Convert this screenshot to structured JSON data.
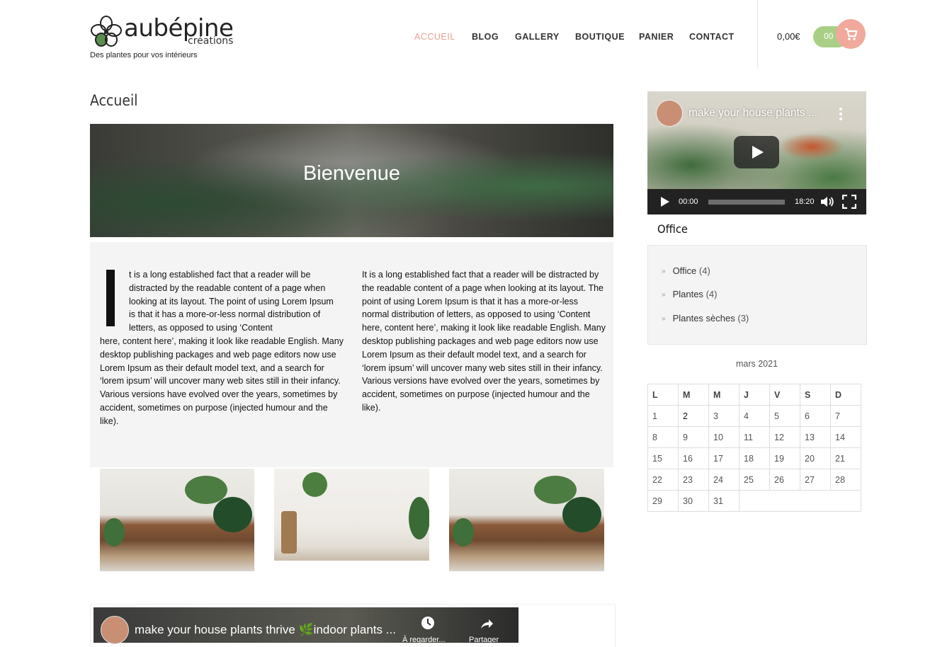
{
  "brand": {
    "name": "aubépine",
    "sub": "créations",
    "tagline": "Des plantes pour vos intérieurs"
  },
  "nav": {
    "items": [
      "ACCUEIL",
      "BLOG",
      "GALLERY",
      "BOUTIQUE",
      "PANIER",
      "CONTACT"
    ],
    "active": "ACCUEIL"
  },
  "cart": {
    "total": "0,00€",
    "count": "00"
  },
  "colors": {
    "accent": "#e8a08f",
    "cart_green": "#a9cf86",
    "cart_pink": "#f0a99c"
  },
  "main": {
    "page_title": "Accueil",
    "hero_title": "Bienvenue",
    "dropcap": "I",
    "col1_first": "t is a long established fact that a reader will be distracted by the readable content of a page when looking at its layout. The point of using Lorem Ipsum is that it has a more-or-less normal distribution of letters, as opposed to using ‘Content",
    "col1_rest": "here, content here’, making it look like readable English. Many desktop publishing packages and web page editors now use Lorem Ipsum as their default model text, and a search for ‘lorem ipsum’ will uncover many web sites still in their infancy. Various versions have evolved over the years, sometimes by accident, sometimes on purpose (injected humour and the like).",
    "col2": "It is a long established fact that a reader will be distracted by the readable content of a page when looking at its layout. The point of using Lorem Ipsum is that it has a more-or-less normal distribution of letters, as opposed to using ‘Content here, content here’, making it look like readable English. Many desktop publishing packages and web page editors now use Lorem Ipsum as their default model text, and a search for ‘lorem ipsum’ will uncover many web sites still in their infancy. Various versions have evolved over the years, sometimes by accident, sometimes on purpose (injected humour and the like).",
    "video": {
      "title": "make your house plants thrive 🌿indoor plants ...",
      "action1": "À regarder...",
      "action2": "Partager"
    }
  },
  "sidebar": {
    "video": {
      "title": "make your house plants ...",
      "time_current": "00:00",
      "time_total": "18:20"
    },
    "categories_title": "Office",
    "categories": [
      {
        "name": "Office",
        "count": "(4)"
      },
      {
        "name": "Plantes",
        "count": "(4)"
      },
      {
        "name": "Plantes sèches",
        "count": "(3)"
      }
    ],
    "calendar": {
      "caption": "mars 2021",
      "days": [
        "L",
        "M",
        "M",
        "J",
        "V",
        "S",
        "D"
      ],
      "weeks": [
        [
          "1",
          "2",
          "3",
          "4",
          "5",
          "6",
          "7"
        ],
        [
          "8",
          "9",
          "10",
          "11",
          "12",
          "13",
          "14"
        ],
        [
          "15",
          "16",
          "17",
          "18",
          "19",
          "20",
          "21"
        ],
        [
          "22",
          "23",
          "24",
          "25",
          "26",
          "27",
          "28"
        ],
        [
          "29",
          "30",
          "31",
          "",
          "",
          "",
          ""
        ]
      ],
      "linked_day": "2"
    }
  }
}
